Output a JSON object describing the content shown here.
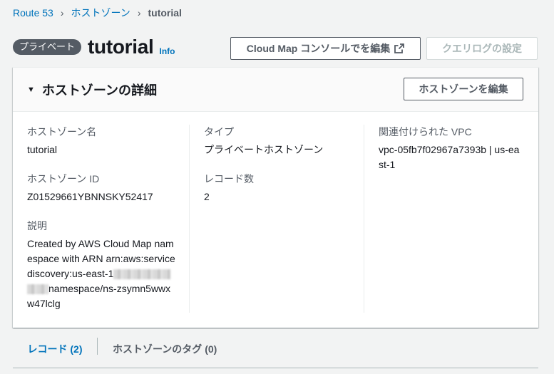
{
  "breadcrumb": {
    "items": [
      "Route 53",
      "ホストゾーン"
    ],
    "current": "tutorial"
  },
  "header": {
    "badge": "プライベート",
    "title": "tutorial",
    "info": "Info"
  },
  "actions": {
    "cloudmap_edit": "Cloud Map コンソールでを編集",
    "query_log": "クエリログの設定"
  },
  "details": {
    "title": "ホストゾーンの詳細",
    "edit_button": "ホストゾーンを編集",
    "fields": {
      "zone_name_label": "ホストゾーン名",
      "zone_name": "tutorial",
      "zone_id_label": "ホストゾーン ID",
      "zone_id": "Z01529661YBNNSKY52417",
      "description_label": "説明",
      "description_part1": "Created by AWS Cloud Map namespace with ARN arn:aws:servicediscovery:us-east-1",
      "description_part2": "namespace/ns-zsymn5wwxw47lclg",
      "type_label": "タイプ",
      "type": "プライベートホストゾーン",
      "record_count_label": "レコード数",
      "record_count": "2",
      "vpc_label": "関連付けられた VPC",
      "vpc": "vpc-05fb7f02967a7393b | us-east-1"
    }
  },
  "tabs": [
    "レコード (2)",
    "ホストゾーンのタグ (0)"
  ],
  "colors": {
    "link": "#0073bb",
    "badge": "#545b64",
    "text": "#16191f"
  },
  "icons": {
    "breadcrumb_separator": "chevron-right-icon",
    "external": "external-link-icon",
    "expand": "caret-down-icon"
  }
}
